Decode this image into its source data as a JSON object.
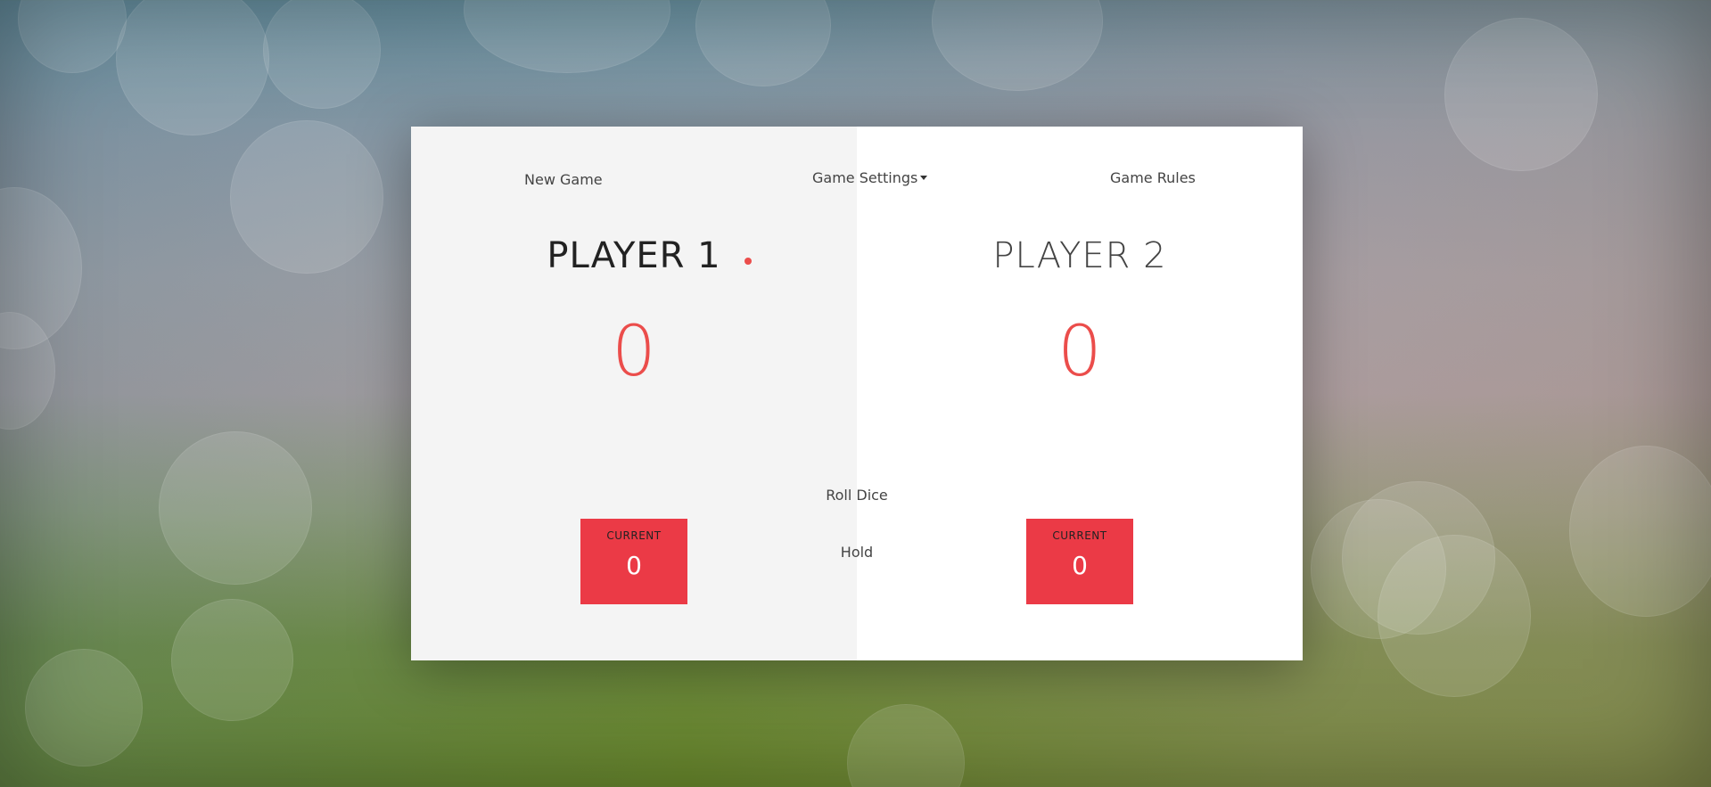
{
  "menu": {
    "new_game": "New Game",
    "settings": "Game Settings",
    "rules": "Game Rules"
  },
  "players": [
    {
      "name": "PLAYER 1",
      "score": "0",
      "current_label": "CURRENT",
      "current_value": "0",
      "active": true
    },
    {
      "name": "PLAYER 2",
      "score": "0",
      "current_label": "CURRENT",
      "current_value": "0",
      "active": false
    }
  ],
  "actions": {
    "roll": "Roll Dice",
    "hold": "Hold"
  },
  "colors": {
    "accent": "#eb4d4b",
    "current_box": "#eb3a46",
    "panel_active": "#f4f4f4",
    "panel_inactive": "#ffffff"
  },
  "icons": {
    "settings_dropdown": "caret-down-icon",
    "active_player": "active-player-dot"
  }
}
